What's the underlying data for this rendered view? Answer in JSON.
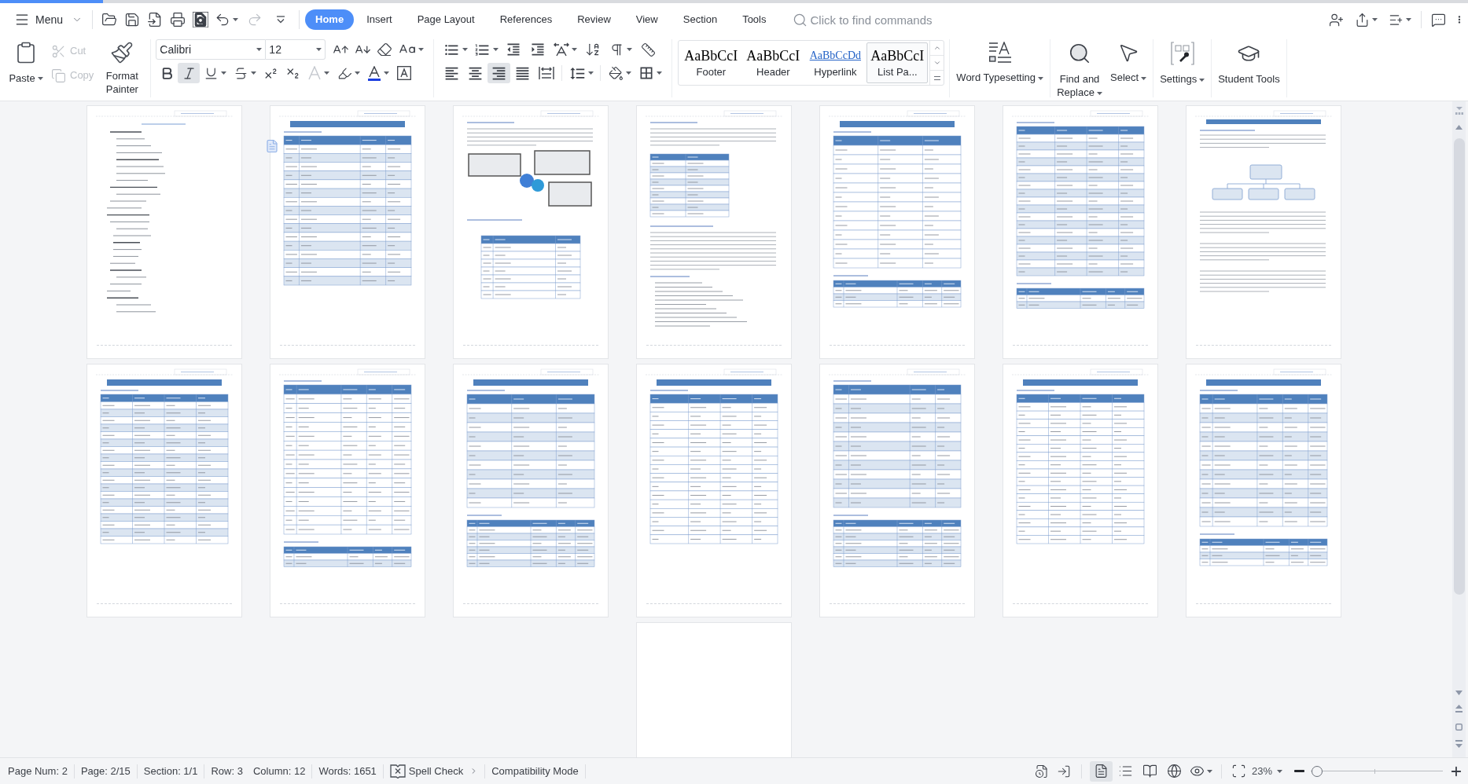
{
  "menu": {
    "label": "Menu"
  },
  "quick_access": [
    {
      "kind": "open",
      "disabled": false
    },
    {
      "kind": "save",
      "disabled": false
    },
    {
      "kind": "export",
      "disabled": false
    },
    {
      "kind": "print",
      "disabled": false
    },
    {
      "kind": "preview",
      "disabled": false
    },
    {
      "kind": "undo",
      "disabled": false
    },
    {
      "kind": "redo",
      "disabled": true
    }
  ],
  "tabs": [
    {
      "label": "Home",
      "selected": true
    },
    {
      "label": "Insert",
      "selected": false
    },
    {
      "label": "Page Layout",
      "selected": false
    },
    {
      "label": "References",
      "selected": false
    },
    {
      "label": "Review",
      "selected": false
    },
    {
      "label": "View",
      "selected": false
    },
    {
      "label": "Section",
      "selected": false
    },
    {
      "label": "Tools",
      "selected": false
    }
  ],
  "search": {
    "placeholder": "Click to find commands"
  },
  "clipboard": {
    "paste": {
      "label": "Paste"
    },
    "cut": {
      "label": "Cut",
      "disabled": true
    },
    "copy": {
      "label": "Copy",
      "disabled": true
    },
    "format_painter": {
      "label": "Format Painter"
    }
  },
  "font": {
    "name": "Calibri",
    "size": "12"
  },
  "character_format": [
    {
      "kind": "bold",
      "on": false
    },
    {
      "kind": "italic",
      "on": true
    },
    {
      "kind": "underline",
      "on": false
    },
    {
      "kind": "strikethrough",
      "on": false
    },
    {
      "kind": "superscript",
      "on": false
    },
    {
      "kind": "subscript",
      "on": false
    }
  ],
  "alignment": [
    {
      "kind": "left",
      "selected": false
    },
    {
      "kind": "center",
      "selected": false
    },
    {
      "kind": "right",
      "selected": true
    },
    {
      "kind": "justify",
      "selected": false
    },
    {
      "kind": "distributed",
      "selected": false
    }
  ],
  "styles": [
    {
      "preview": "AaBbCcI",
      "label": "Footer",
      "kind": "plain",
      "selected": false
    },
    {
      "preview": "AaBbCcI",
      "label": "Header",
      "kind": "plain",
      "selected": false
    },
    {
      "preview": "AaBbCcDd",
      "label": "Hyperlink",
      "kind": "link",
      "selected": false
    },
    {
      "preview": "AaBbCcI",
      "label": "List Pa...",
      "kind": "plain",
      "selected": true
    }
  ],
  "tool_groups": [
    [
      {
        "kind": "typesetting",
        "label": "Word Typesetting",
        "caret": true
      }
    ],
    [
      {
        "kind": "find",
        "label": "Find and Replace",
        "caret": true
      },
      {
        "kind": "select",
        "label": "Select",
        "caret": true
      }
    ],
    [
      {
        "kind": "settings",
        "label": "Settings",
        "caret": true
      }
    ],
    [
      {
        "kind": "student",
        "label": "Student Tools",
        "caret": false
      }
    ]
  ],
  "pages": [
    {
      "kind": "outline",
      "current": false
    },
    {
      "kind": "table",
      "current": true
    },
    {
      "kind": "mixed",
      "current": false
    },
    {
      "kind": "mixed",
      "current": false
    },
    {
      "kind": "table",
      "current": false
    },
    {
      "kind": "table",
      "current": false
    },
    {
      "kind": "text",
      "current": false
    },
    {
      "kind": "table",
      "current": false
    },
    {
      "kind": "table",
      "current": false
    },
    {
      "kind": "table",
      "current": false
    },
    {
      "kind": "table",
      "current": false
    },
    {
      "kind": "table",
      "current": false
    },
    {
      "kind": "table",
      "current": false
    },
    {
      "kind": "table",
      "current": false
    },
    {
      "kind": "blank",
      "current": false
    }
  ],
  "status_bar": {
    "field_groups": [
      [
        "Page Num: 2"
      ],
      [
        "Page: 2/15"
      ],
      [
        "Section: 1/1"
      ],
      [
        "Row: 3",
        "Column: 12"
      ],
      [
        "Words: 1651"
      ]
    ],
    "spell_check": "Spell Check",
    "compatibility": "Compatibility Mode",
    "view_modes": [
      {
        "kind": "page",
        "selected": true
      },
      {
        "kind": "outline",
        "selected": false
      },
      {
        "kind": "reading",
        "selected": false
      },
      {
        "kind": "web",
        "selected": false
      },
      {
        "kind": "eye",
        "selected": false
      }
    ],
    "zoom": "23%",
    "zoom_slider": {
      "level": 0.05
    }
  }
}
